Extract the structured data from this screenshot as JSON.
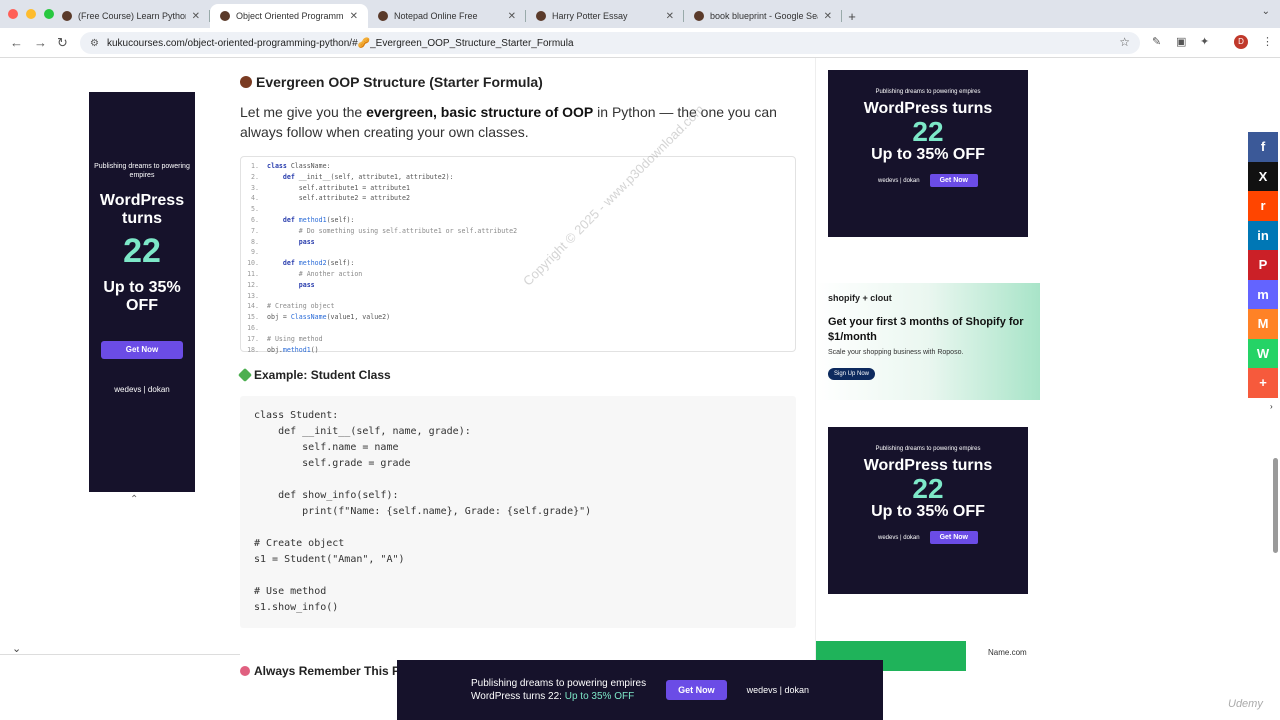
{
  "browser": {
    "tabs": [
      {
        "title": "(Free Course) Learn Python B",
        "active": false
      },
      {
        "title": "Object Oriented Programming",
        "active": true
      },
      {
        "title": "Notepad Online Free",
        "active": false
      },
      {
        "title": "Harry Potter Essay",
        "active": false
      },
      {
        "title": "book blueprint - Google Sear",
        "active": false
      }
    ],
    "url": "kukucourses.com/object-oriented-programming-python/#🥜_Evergreen_OOP_Structure_Starter_Formula"
  },
  "article": {
    "heading1": "Evergreen OOP Structure (Starter Formula)",
    "intro_pre": "Let me give you the ",
    "intro_bold": "evergreen, basic structure of OOP",
    "intro_post": " in Python — the one you can always follow when creating your own classes.",
    "code1": [
      "class ClassName:",
      "    def __init__(self, attribute1, attribute2):",
      "        self.attribute1 = attribute1",
      "        self.attribute2 = attribute2",
      "",
      "    def method1(self):",
      "        # Do something using self.attribute1 or self.attribute2",
      "        pass",
      "",
      "    def method2(self):",
      "        # Another action",
      "        pass",
      "",
      "# Creating object",
      "obj = ClassName(value1, value2)",
      "",
      "# Using method",
      "obj.method1()"
    ],
    "heading2": "Example: Student Class",
    "code2": "class Student:\n    def __init__(self, name, grade):\n        self.name = name\n        self.grade = grade\n\n    def show_info(self):\n        print(f\"Name: {self.name}, Grade: {self.grade}\")\n\n# Create object\ns1 = Student(\"Aman\", \"A\")\n\n# Use method\ns1.show_info()",
    "heading3": "Always Remember This Pattern:"
  },
  "watermark": "Copyright © 2025 - www.p30download.com",
  "ads": {
    "wp_tag": "Publishing dreams to powering empires",
    "wp_title": "WordPress turns",
    "wp_number": "22",
    "wp_off": "Up to 35% OFF",
    "wp_button": "Get Now",
    "wp_brands": "wedevs | dokan",
    "shopify_brand": "shopify + clout",
    "shopify_headline": "Get your first 3 months of Shopify for $1/month",
    "shopify_sub": "Scale your shopping business with Roposo.",
    "shopify_button": "Sign Up Now",
    "bottom_line1": "Publishing dreams to powering empires",
    "bottom_line2_a": "WordPress turns 22: ",
    "bottom_line2_b": "Up to 35% OFF",
    "namecom": "Name.com"
  },
  "social": [
    {
      "name": "facebook",
      "color": "#3b5998",
      "glyph": "f"
    },
    {
      "name": "x",
      "color": "#111111",
      "glyph": "X"
    },
    {
      "name": "reddit",
      "color": "#ff4500",
      "glyph": "r"
    },
    {
      "name": "linkedin",
      "color": "#0077b5",
      "glyph": "in"
    },
    {
      "name": "pinterest",
      "color": "#cb2027",
      "glyph": "P"
    },
    {
      "name": "mastodon",
      "color": "#6364ff",
      "glyph": "m"
    },
    {
      "name": "mix",
      "color": "#ff8226",
      "glyph": "M"
    },
    {
      "name": "whatsapp",
      "color": "#25d366",
      "glyph": "W"
    },
    {
      "name": "more",
      "color": "#f65a3c",
      "glyph": "+"
    }
  ],
  "watermark_udemy": "Udemy"
}
